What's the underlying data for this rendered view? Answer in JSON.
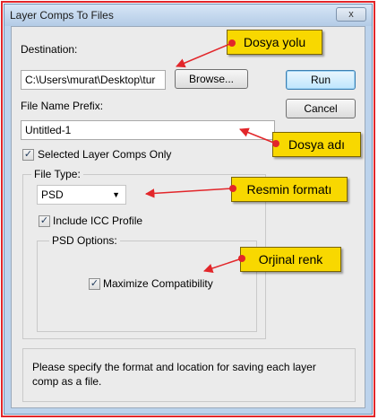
{
  "window": {
    "title": "Layer Comps To Files",
    "close_label": "x"
  },
  "destination": {
    "label": "Destination:",
    "value": "C:\\Users\\murat\\Desktop\\tur",
    "browse_label": "Browse..."
  },
  "buttons": {
    "run_label": "Run",
    "cancel_label": "Cancel"
  },
  "prefix": {
    "label": "File Name Prefix:",
    "value": "Untitled-1"
  },
  "selected_only": {
    "label": "Selected Layer Comps Only",
    "checked": true
  },
  "file_type": {
    "legend": "File Type:",
    "selected": "PSD",
    "include_icc_label": "Include ICC Profile",
    "include_icc_checked": true
  },
  "psd_options": {
    "legend": "PSD Options:",
    "maximize_label": "Maximize Compatibility",
    "maximize_checked": true
  },
  "info_text": "Please specify the format and location for saving each layer comp as a file.",
  "callouts": {
    "destination": "Dosya yolu",
    "prefix": "Dosya adı",
    "format": "Resmin formatı",
    "compat": "Orjinal renk"
  },
  "colors": {
    "callout_fill": "#f8d800",
    "arrow": "#e2262a",
    "border": "#e2262a"
  },
  "icons": {
    "check": "✓",
    "dropdown": "▼"
  }
}
